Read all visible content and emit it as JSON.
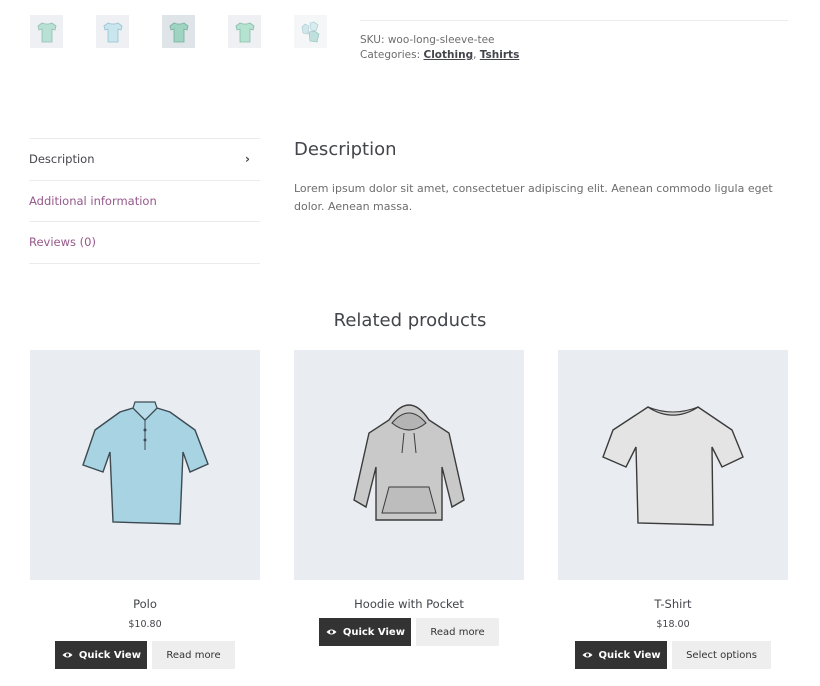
{
  "meta": {
    "sku_label": "SKU:",
    "sku_value": "woo-long-sleeve-tee",
    "categories_label": "Categories:",
    "categories": [
      "Clothing",
      "Tshirts"
    ],
    "categories_sep": ","
  },
  "thumbnails": [
    {
      "icon": "tshirt-thumb-icon"
    },
    {
      "icon": "tshirt-thumb-icon"
    },
    {
      "icon": "tshirt-thumb-icon"
    },
    {
      "icon": "tshirt-thumb-icon"
    },
    {
      "icon": "tshirt-thumb-icon"
    }
  ],
  "tabs": [
    {
      "label": "Description",
      "active": true
    },
    {
      "label": "Additional information",
      "active": false
    },
    {
      "label": "Reviews (0)",
      "active": false
    }
  ],
  "description": {
    "title": "Description",
    "text": "Lorem ipsum dolor sit amet, consectetuer adipiscing elit. Aenean commodo ligula eget dolor. Aenean massa."
  },
  "related": {
    "title": "Related products",
    "products": [
      {
        "name": "Polo",
        "price": "$10.80",
        "quick_view": "Quick View",
        "action": "Read more",
        "image": "polo-shirt-image"
      },
      {
        "name": "Hoodie with Pocket",
        "price": "",
        "quick_view": "Quick View",
        "action": "Read more",
        "image": "hoodie-image"
      },
      {
        "name": "T-Shirt",
        "price": "$18.00",
        "quick_view": "Quick View",
        "action": "Select options",
        "image": "tshirt-image"
      }
    ]
  },
  "colors": {
    "accent": "#96588a",
    "dark_button": "#333333",
    "light_button": "#eeeeee",
    "image_bg": "#e9edf2"
  }
}
